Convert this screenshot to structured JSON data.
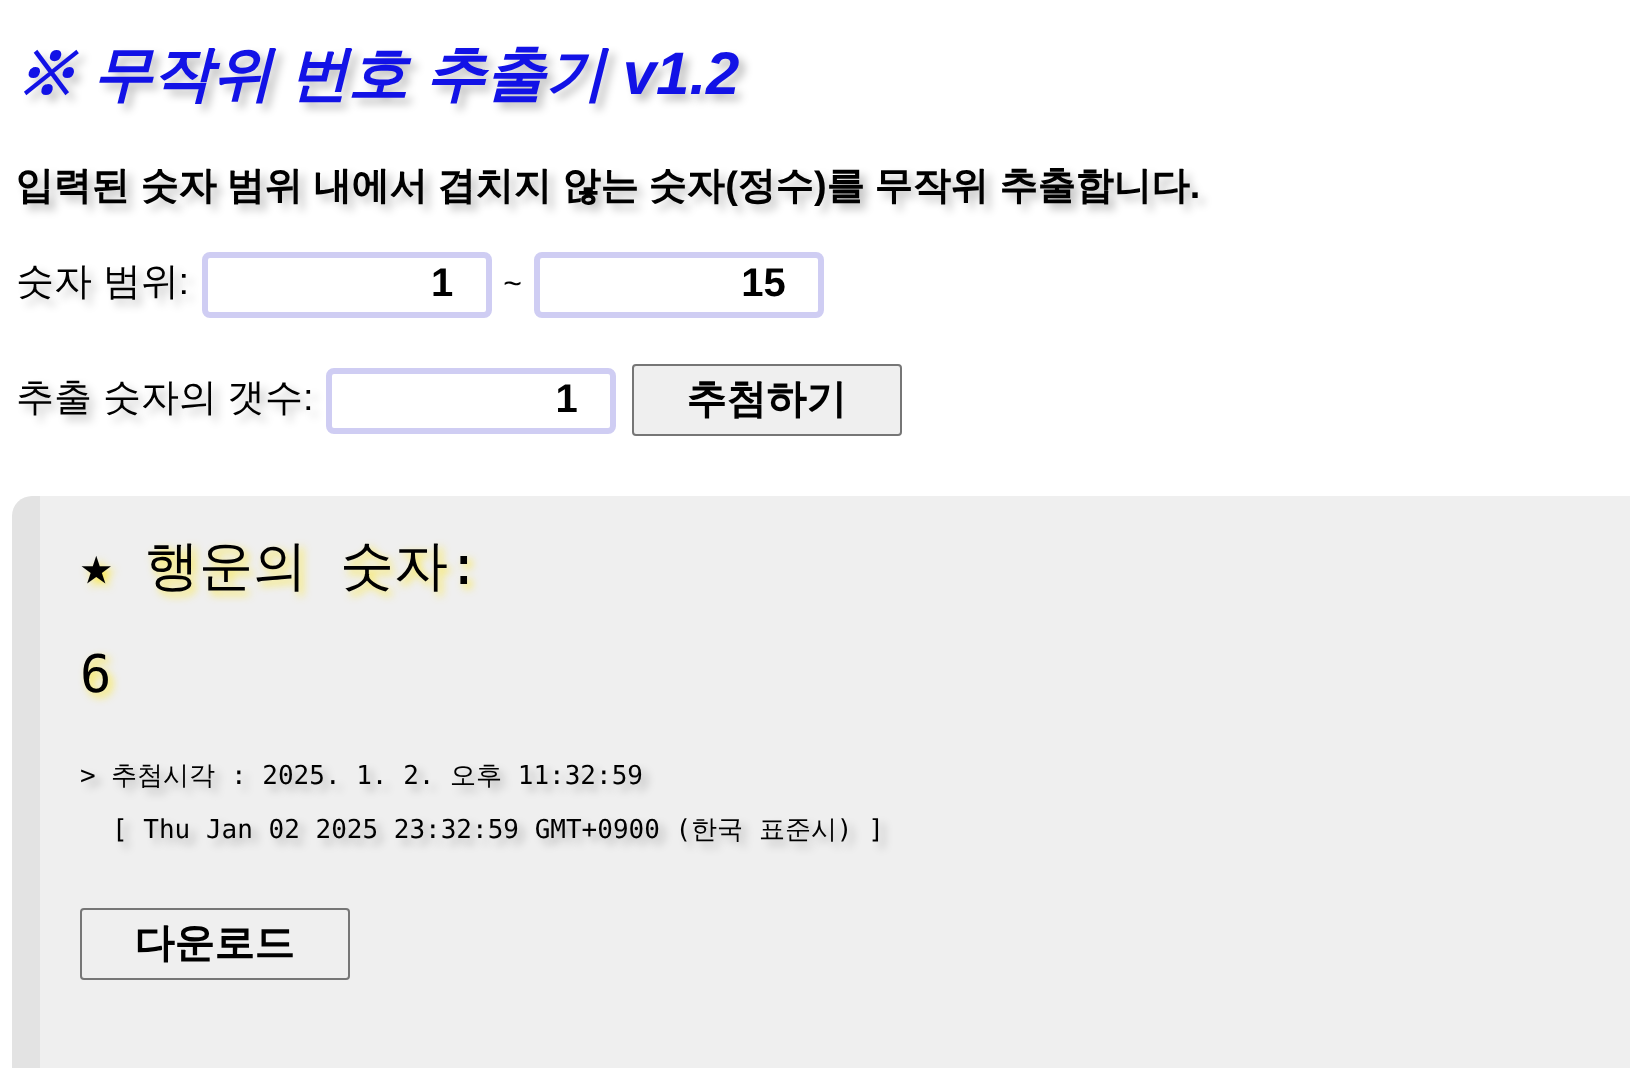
{
  "title": "※ 무작위 번호 추출기 v1.2",
  "description": "입력된 숫자 범위 내에서 겹치지 않는 숫자(정수)를 무작위 추출합니다.",
  "range": {
    "label": "숫자 범위:",
    "from": "1",
    "separator": "~",
    "to": "15"
  },
  "count": {
    "label": "추출 숫자의 갯수:",
    "value": "1",
    "button": "추첨하기"
  },
  "result": {
    "heading": "★ 행운의 숫자:",
    "numbers": "6",
    "drawn_time": "> 추첨시각 : 2025. 1. 2. 오후 11:32:59",
    "drawn_time_full": "[ Thu Jan 02 2025 23:32:59 GMT+0900 (한국 표준시) ]",
    "download_button": "다운로드"
  }
}
